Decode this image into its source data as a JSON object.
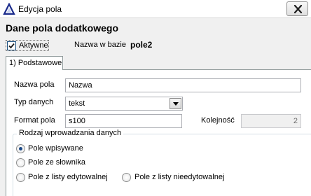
{
  "window": {
    "title": "Edycja pola",
    "icons": {
      "app": "triangle-delta-icon",
      "close": "close-icon"
    }
  },
  "header": {
    "title": "Dane pola dodatkowego",
    "active_label": "Aktywne",
    "active_checked": true,
    "db_name_label": "Nazwa w bazie",
    "db_name_value": "pole2"
  },
  "tabs": [
    {
      "label": "1) Podstawowe",
      "active": true
    }
  ],
  "form": {
    "name_label": "Nazwa pola",
    "name_value": "Nazwa",
    "type_label": "Typ danych",
    "type_value": "tekst",
    "format_label": "Format pola",
    "format_value": "s100",
    "order_label": "Kolejność",
    "order_value": "2"
  },
  "input_mode": {
    "group_label": "Rodzaj wprowadzania danych",
    "options": [
      {
        "label": "Pole wpisywane",
        "selected": true
      },
      {
        "label": "Pole ze słownika",
        "selected": false
      },
      {
        "label": "Pole z listy edytowalnej",
        "selected": false
      },
      {
        "label": "Pole z listy nieedytowalnej",
        "selected": false
      }
    ]
  },
  "colors": {
    "app_icon": "#1a2b8c",
    "close_x": "#1e1e1e",
    "radio_dot": "#1c4a88"
  }
}
